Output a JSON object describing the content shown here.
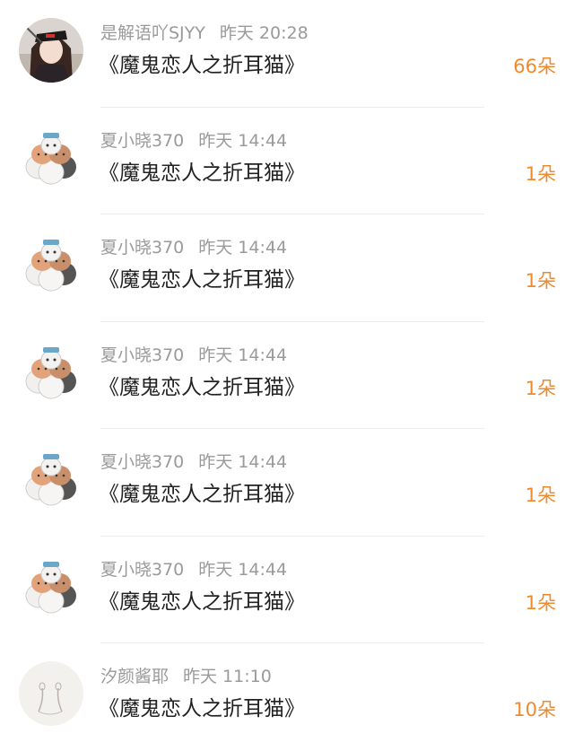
{
  "comments": [
    {
      "name": "是解语吖SJYY",
      "time": "昨天 20:28",
      "title": "《魔鬼恋人之折耳猫》",
      "count": "66朵",
      "avatar": "anime-girl-avatar"
    },
    {
      "name": "夏小晓370",
      "time": "昨天 14:44",
      "title": "《魔鬼恋人之折耳猫》",
      "count": "1朵",
      "avatar": "cats-avatar"
    },
    {
      "name": "夏小晓370",
      "time": "昨天 14:44",
      "title": "《魔鬼恋人之折耳猫》",
      "count": "1朵",
      "avatar": "cats-avatar"
    },
    {
      "name": "夏小晓370",
      "time": "昨天 14:44",
      "title": "《魔鬼恋人之折耳猫》",
      "count": "1朵",
      "avatar": "cats-avatar"
    },
    {
      "name": "夏小晓370",
      "time": "昨天 14:44",
      "title": "《魔鬼恋人之折耳猫》",
      "count": "1朵",
      "avatar": "cats-avatar"
    },
    {
      "name": "夏小晓370",
      "time": "昨天 14:44",
      "title": "《魔鬼恋人之折耳猫》",
      "count": "1朵",
      "avatar": "cats-avatar"
    },
    {
      "name": "汐颜酱耶",
      "time": "昨天 11:10",
      "title": "《魔鬼恋人之折耳猫》",
      "count": "10朵",
      "avatar": "sketch-avatar"
    }
  ],
  "colors": {
    "accent": "#f08a2c",
    "meta_text": "#9a9a9a",
    "title_text": "#222222"
  }
}
